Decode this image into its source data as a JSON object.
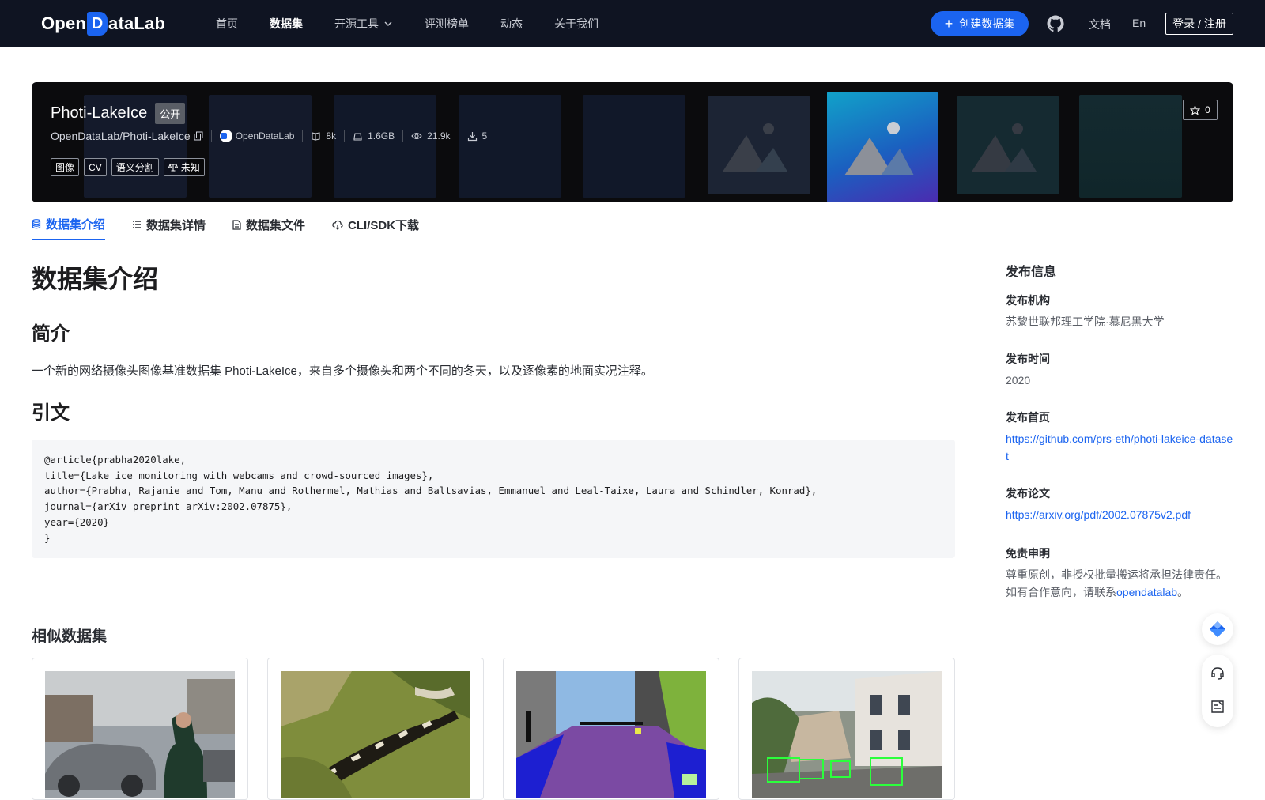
{
  "nav": {
    "logo_left": "Open",
    "logo_d": "D",
    "logo_right": "ataLab",
    "links": [
      {
        "label": "首页",
        "active": false
      },
      {
        "label": "数据集",
        "active": true
      },
      {
        "label": "开源工具",
        "active": false,
        "dropdown": true
      },
      {
        "label": "评测榜单",
        "active": false
      },
      {
        "label": "动态",
        "active": false
      },
      {
        "label": "关于我们",
        "active": false
      }
    ],
    "create_label": "创建数据集",
    "doc_label": "文档",
    "lang_label": "En",
    "login_label": "登录 / 注册"
  },
  "banner": {
    "title": "Photi-LakeIce",
    "visibility": "公开",
    "repo": "OpenDataLab/Photi-LakeIce",
    "org": "OpenDataLab",
    "files": "8k",
    "size": "1.6GB",
    "views": "21.9k",
    "downloads": "5",
    "tags": [
      "图像",
      "CV",
      "语义分割"
    ],
    "license": "未知",
    "stars": "0"
  },
  "tabs": [
    {
      "label": "数据集介绍",
      "icon": "database-icon",
      "active": true
    },
    {
      "label": "数据集详情",
      "icon": "list-icon",
      "active": false
    },
    {
      "label": "数据集文件",
      "icon": "file-icon",
      "active": false
    },
    {
      "label": "CLI/SDK下载",
      "icon": "cloud-download-icon",
      "active": false
    }
  ],
  "main": {
    "heading": "数据集介绍",
    "intro_heading": "简介",
    "intro_text": "一个新的网络摄像头图像基准数据集 Photi-LakeIce，来自多个摄像头和两个不同的冬天，以及逐像素的地面实况注释。",
    "citation_heading": "引文",
    "citation": "@article{prabha2020lake,\ntitle={Lake ice monitoring with webcams and crowd-sourced images},\nauthor={Prabha, Rajanie and Tom, Manu and Rothermel, Mathias and Baltsavias, Emmanuel and Leal-Taixe, Laura and Schindler, Konrad},\njournal={arXiv preprint arXiv:2002.07875},\nyear={2020}\n}",
    "similar_heading": "相似数据集"
  },
  "sidebar": {
    "title": "发布信息",
    "org_label": "发布机构",
    "org_value": "苏黎世联邦理工学院·慕尼黑大学",
    "time_label": "发布时间",
    "time_value": "2020",
    "home_label": "发布首页",
    "home_value": "https://github.com/prs-eth/photi-lakeice-dataset",
    "paper_label": "发布论文",
    "paper_value": "https://arxiv.org/pdf/2002.07875v2.pdf",
    "disclaimer_label": "免责申明",
    "disclaimer_line1": "尊重原创，非授权批量搬运将承担法律责任。",
    "disclaimer_line2_prefix": "如有合作意向，请联系",
    "disclaimer_link": "opendatalab",
    "disclaimer_suffix": "。"
  },
  "colors": {
    "nav_bg": "#0f1422",
    "accent": "#1b64f0",
    "banner_bg": "#0b0b0d"
  }
}
